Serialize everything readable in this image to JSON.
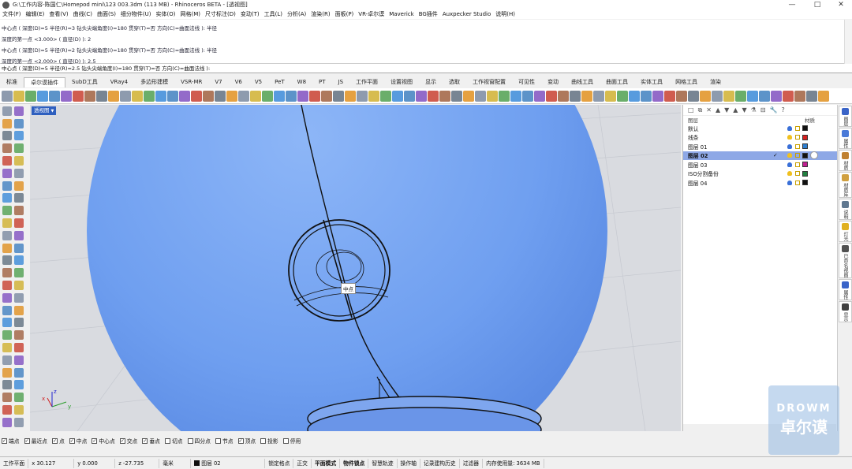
{
  "window": {
    "title": "G:\\工作内容-陈国仁\\Homepod mini\\123 003.3dm (113 MB) - Rhinoceros BETA - [透视图]",
    "controls": [
      "—",
      "□",
      "✕"
    ]
  },
  "menu": [
    "文件(F)",
    "编辑(E)",
    "查看(V)",
    "曲线(C)",
    "曲面(S)",
    "细分物件(U)",
    "实体(O)",
    "网格(M)",
    "尺寸标注(D)",
    "变动(T)",
    "工具(L)",
    "分析(A)",
    "渲染(R)",
    "面板(P)",
    "VR-卓尔谟",
    "Maverick",
    "BG插件",
    "Auxpecker Studio",
    "说明(H)"
  ],
  "command_history": [
    "中心点 ( 深度(D)=5  半径(R)=3  钻头尖端角度(I)=180  贯穿(T)=否  方向(C)=曲面法线 ): 半径",
    "深度的第一点 <3.000> ( 直径(D) ): 2",
    "中心点 ( 深度(D)=5  半径(R)=2  钻头尖端角度(I)=180  贯穿(T)=否  方向(C)=曲面法线 ): 半径",
    "深度的第一点 <2.000> ( 直径(D) ): 2.5"
  ],
  "command_prompt": "中心点 ( 深度(D)=5  半径(R)=2.5  钻头尖端角度(I)=180  贯穿(T)=否  方向(C)=曲面法线 ):",
  "toolbar_tabs": [
    "标准",
    "卓尔谟插件",
    "SubD工具",
    "VRay4",
    "多边形建模",
    "VSR-MR",
    "V7",
    "V6",
    "V5",
    "PeT",
    "W8",
    "PT",
    "JS",
    "工作平面",
    "设置视图",
    "显示",
    "选取",
    "工作视窗配置",
    "可见性",
    "变动",
    "曲线工具",
    "曲面工具",
    "实体工具",
    "网格工具",
    "渲染"
  ],
  "active_tab_index": 1,
  "viewport": {
    "name": "透视图",
    "snap_tooltip": "中点",
    "axis": {
      "x": "x",
      "y": "y",
      "z": "z"
    }
  },
  "layers": {
    "toolbar_icons": [
      "□",
      "⧉",
      "✕",
      "▲",
      "▼",
      "▲",
      "▼",
      "⚗",
      "⊟",
      "🔧",
      "?"
    ],
    "col_name": "图层",
    "col_material": "材质",
    "rows": [
      {
        "name": "默认",
        "color": "#111111",
        "current": false,
        "selected": false
      },
      {
        "name": "线条",
        "color": "#d62020",
        "current": false,
        "selected": false
      },
      {
        "name": "图层 01",
        "color": "#2f7fd0",
        "current": false,
        "selected": false
      },
      {
        "name": "图层 02",
        "color": "#111111",
        "current": true,
        "selected": true,
        "check": "✓"
      },
      {
        "name": "图层 03",
        "color": "#c02090",
        "current": false,
        "selected": false
      },
      {
        "name": "ISO分割备份",
        "color": "#208040",
        "current": false,
        "selected": false
      },
      {
        "name": "图层 04",
        "color": "#111111",
        "current": false,
        "selected": false
      }
    ]
  },
  "right_tabs": [
    {
      "label": "图层",
      "color": "#3a64c8"
    },
    {
      "label": "属性",
      "color": "#4a7ad8"
    },
    {
      "label": "材质",
      "color": "#c08030"
    },
    {
      "label": "材质库",
      "color": "#d0a040"
    },
    {
      "label": "说明",
      "color": "#607890"
    },
    {
      "label": "灯光",
      "color": "#e0b020"
    },
    {
      "label": "已命名视图",
      "color": "#505050"
    },
    {
      "label": "属性",
      "color": "#3a64c8"
    },
    {
      "label": "显示",
      "color": "#404040"
    }
  ],
  "osnaps": [
    {
      "label": "端点",
      "checked": true
    },
    {
      "label": "最近点",
      "checked": true
    },
    {
      "label": "点",
      "checked": true
    },
    {
      "label": "中点",
      "checked": true
    },
    {
      "label": "中心点",
      "checked": true
    },
    {
      "label": "交点",
      "checked": true
    },
    {
      "label": "垂点",
      "checked": true
    },
    {
      "label": "切点",
      "checked": false
    },
    {
      "label": "四分点",
      "checked": false
    },
    {
      "label": "节点",
      "checked": false
    },
    {
      "label": "顶点",
      "checked": true
    },
    {
      "label": "投影",
      "checked": false
    },
    {
      "label": "停用",
      "checked": false
    }
  ],
  "status": {
    "cplane": "工作平面",
    "x": "x 30.127",
    "y": "y 0.000",
    "z": "z -27.735",
    "units": "毫米",
    "layer": "图层 02",
    "toggles": [
      "锁定格点",
      "正交",
      "平面模式",
      "物件锁点",
      "智慧轨迹",
      "操作轴",
      "记录建构历史",
      "过滤器"
    ],
    "bold_toggles": [
      "平面模式",
      "物件锁点"
    ],
    "memory": "内存使用量: 3634 MB"
  },
  "watermark": {
    "line1": "DROWM",
    "line2": "卓尔谟"
  },
  "colors": {
    "sphere": "#6f9ff0",
    "accent": "#2e5fbf",
    "selection": "#8ea8e6"
  }
}
